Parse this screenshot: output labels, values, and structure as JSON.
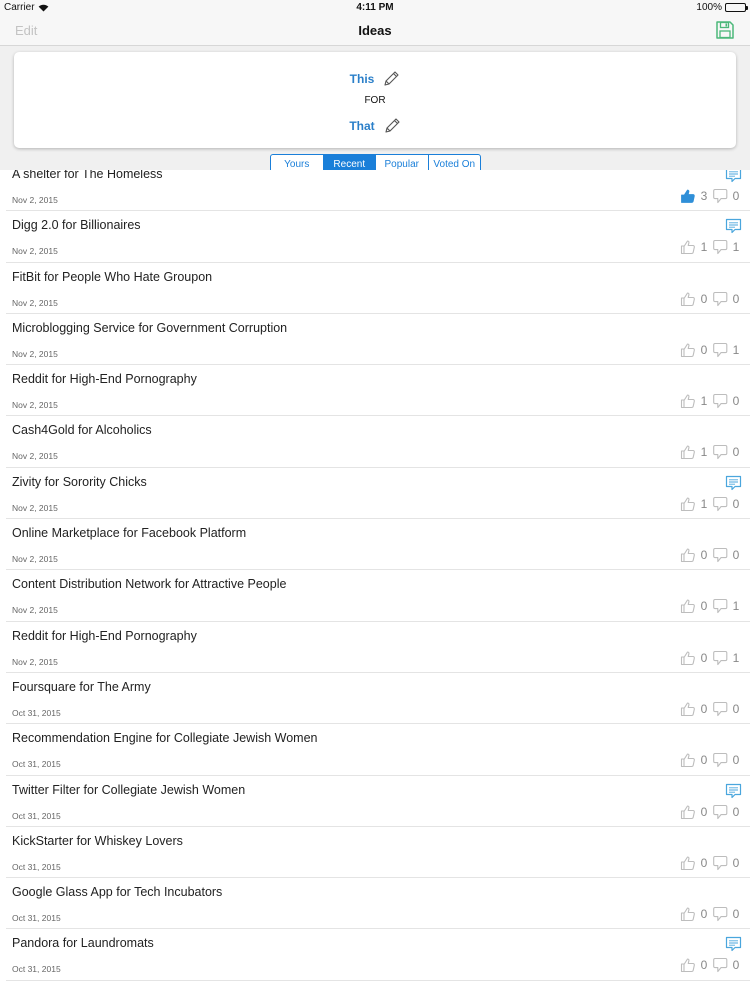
{
  "status_bar": {
    "carrier": "Carrier",
    "time": "4:11 PM",
    "battery": "100%"
  },
  "nav": {
    "edit_label": "Edit",
    "title": "Ideas",
    "save_icon": "save-icon",
    "save_color": "#4cb87a"
  },
  "card": {
    "top_word": "This",
    "connector": "FOR",
    "bottom_word": "That",
    "word_color": "#2a7fc9"
  },
  "segments": [
    {
      "label": "Yours",
      "active": false
    },
    {
      "label": "Recent",
      "active": true
    },
    {
      "label": "Popular",
      "active": false
    },
    {
      "label": "Voted On",
      "active": false
    }
  ],
  "accent_color": "#1a7fd9",
  "ideas": [
    {
      "title": "A shelter for The Homeless",
      "date": "Nov 2, 2015",
      "up": "3",
      "down": "0",
      "comment": true,
      "upvoted": true
    },
    {
      "title": "Digg 2.0 for Billionaires",
      "date": "Nov 2, 2015",
      "up": "1",
      "down": "1",
      "comment": true,
      "upvoted": false
    },
    {
      "title": "FitBit for People Who Hate Groupon",
      "date": "Nov 2, 2015",
      "up": "0",
      "down": "0",
      "comment": false,
      "upvoted": false
    },
    {
      "title": "Microblogging Service for Government Corruption",
      "date": "Nov 2, 2015",
      "up": "0",
      "down": "1",
      "comment": false,
      "upvoted": false
    },
    {
      "title": "Reddit for High-End Pornography",
      "date": "Nov 2, 2015",
      "up": "1",
      "down": "0",
      "comment": false,
      "upvoted": false
    },
    {
      "title": "Cash4Gold for Alcoholics",
      "date": "Nov 2, 2015",
      "up": "1",
      "down": "0",
      "comment": false,
      "upvoted": false
    },
    {
      "title": "Zivity for Sorority Chicks",
      "date": "Nov 2, 2015",
      "up": "1",
      "down": "0",
      "comment": true,
      "upvoted": false
    },
    {
      "title": "Online Marketplace for Facebook Platform",
      "date": "Nov 2, 2015",
      "up": "0",
      "down": "0",
      "comment": false,
      "upvoted": false
    },
    {
      "title": "Content Distribution Network for Attractive People",
      "date": "Nov 2, 2015",
      "up": "0",
      "down": "1",
      "comment": false,
      "upvoted": false
    },
    {
      "title": "Reddit for High-End Pornography",
      "date": "Nov 2, 2015",
      "up": "0",
      "down": "1",
      "comment": false,
      "upvoted": false
    },
    {
      "title": "Foursquare for The Army",
      "date": "Oct 31, 2015",
      "up": "0",
      "down": "0",
      "comment": false,
      "upvoted": false
    },
    {
      "title": "Recommendation Engine for Collegiate Jewish Women",
      "date": "Oct 31, 2015",
      "up": "0",
      "down": "0",
      "comment": false,
      "upvoted": false
    },
    {
      "title": "Twitter Filter for Collegiate Jewish Women",
      "date": "Oct 31, 2015",
      "up": "0",
      "down": "0",
      "comment": true,
      "upvoted": false
    },
    {
      "title": "KickStarter for Whiskey Lovers",
      "date": "Oct 31, 2015",
      "up": "0",
      "down": "0",
      "comment": false,
      "upvoted": false
    },
    {
      "title": "Google Glass App for Tech Incubators",
      "date": "Oct 31, 2015",
      "up": "0",
      "down": "0",
      "comment": false,
      "upvoted": false
    },
    {
      "title": "Pandora for Laundromats",
      "date": "Oct 31, 2015",
      "up": "0",
      "down": "0",
      "comment": true,
      "upvoted": false
    }
  ]
}
